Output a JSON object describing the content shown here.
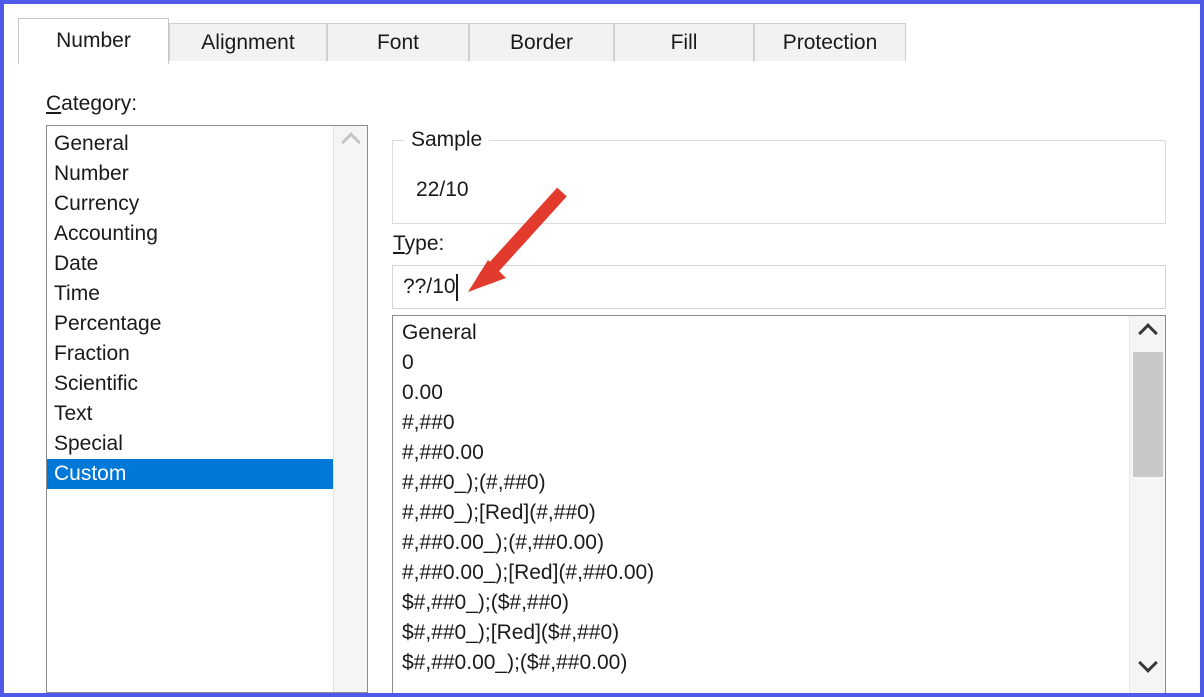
{
  "dialog": {
    "frame_color": "#4f5ae8",
    "tabs": [
      {
        "label": "Number",
        "active": true
      },
      {
        "label": "Alignment",
        "active": false
      },
      {
        "label": "Font",
        "active": false
      },
      {
        "label": "Border",
        "active": false
      },
      {
        "label": "Fill",
        "active": false
      },
      {
        "label": "Protection",
        "active": false
      }
    ]
  },
  "category": {
    "label_accel": "C",
    "label_rest": "ategory:",
    "items": [
      {
        "label": "General",
        "selected": false
      },
      {
        "label": "Number",
        "selected": false
      },
      {
        "label": "Currency",
        "selected": false
      },
      {
        "label": "Accounting",
        "selected": false
      },
      {
        "label": "Date",
        "selected": false
      },
      {
        "label": "Time",
        "selected": false
      },
      {
        "label": "Percentage",
        "selected": false
      },
      {
        "label": "Fraction",
        "selected": false
      },
      {
        "label": "Scientific",
        "selected": false
      },
      {
        "label": "Text",
        "selected": false
      },
      {
        "label": "Special",
        "selected": false
      },
      {
        "label": "Custom",
        "selected": true
      }
    ],
    "selection_color": "#0078d7"
  },
  "sample": {
    "legend": "Sample",
    "value": "22/10"
  },
  "type": {
    "label_accel": "T",
    "label_rest": "ype:",
    "value": "??/10"
  },
  "format_list": {
    "items": [
      "General",
      "0",
      "0.00",
      "#,##0",
      "#,##0.00",
      "#,##0_);(#,##0)",
      "#,##0_);[Red](#,##0)",
      "#,##0.00_);(#,##0.00)",
      "#,##0.00_);[Red](#,##0.00)",
      "$#,##0_);($#,##0)",
      "$#,##0_);[Red]($#,##0)",
      "$#,##0.00_);($#,##0.00)"
    ]
  },
  "annotation": {
    "arrow_color": "#e23b2e"
  }
}
